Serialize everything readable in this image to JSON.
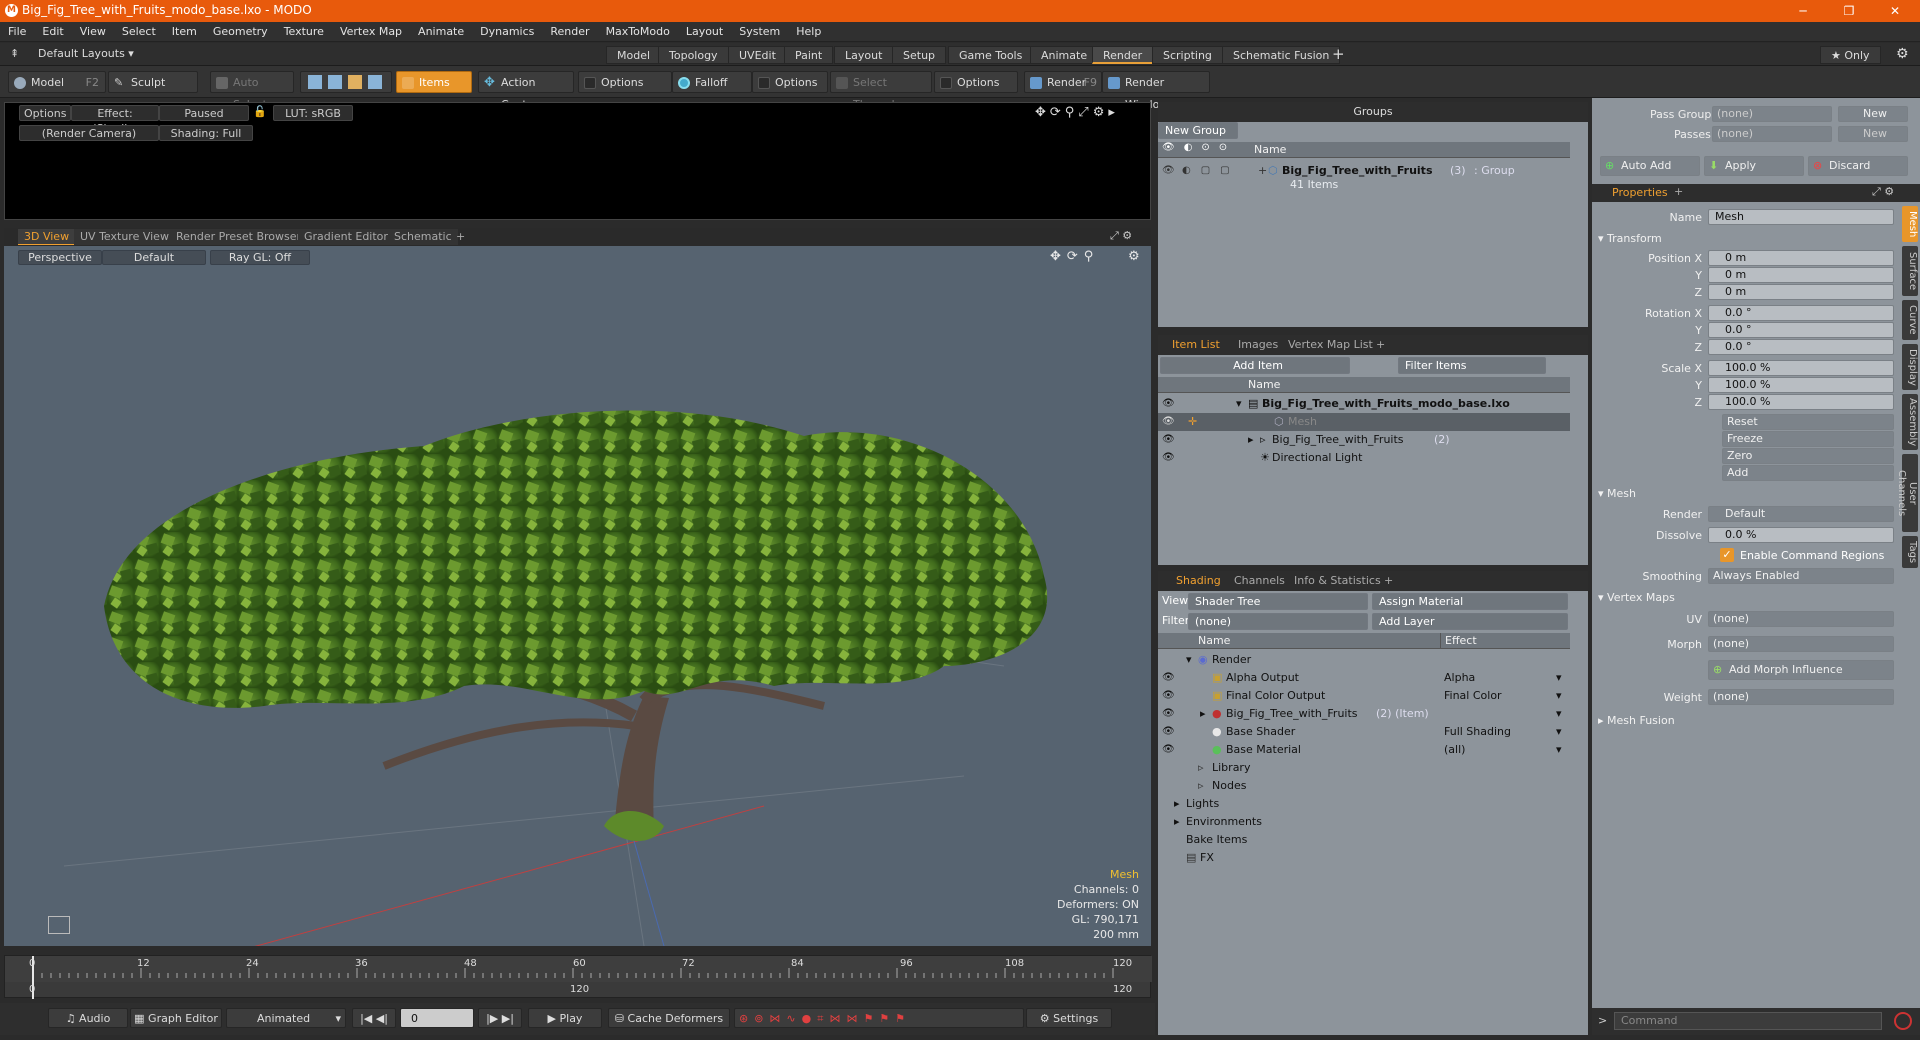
{
  "window": {
    "title": "Big_Fig_Tree_with_Fruits_modo_base.lxo - MODO",
    "logo": "M"
  },
  "menu": [
    "File",
    "Edit",
    "View",
    "Select",
    "Item",
    "Geometry",
    "Texture",
    "Vertex Map",
    "Animate",
    "Dynamics",
    "Render",
    "MaxToModo",
    "Layout",
    "System",
    "Help"
  ],
  "layouts": {
    "default": "Default Layouts ▾",
    "tabs": [
      "Model",
      "Topology",
      "UVEdit",
      "Paint",
      "Layout",
      "Setup",
      "Game Tools",
      "Animate",
      "Render",
      "Scripting",
      "Schematic Fusion"
    ],
    "active": "Render",
    "only": "★ Only"
  },
  "toolbar": {
    "model": "Model",
    "model_key": "F2",
    "sculpt": "Sculpt",
    "auto_select": "Auto Select",
    "items": "Items",
    "action_center": "Action Center",
    "options1": "Options",
    "falloff": "Falloff",
    "options2": "Options",
    "select_through": "Select Through",
    "options3": "Options",
    "render": "Render",
    "render_key": "F9",
    "render_window": "Render Window"
  },
  "render_preview": {
    "options": "Options",
    "effect": "Effect: (Shadi...",
    "paused": "Paused",
    "lut": "LUT: sRGB",
    "camera": "(Render Camera)",
    "shading": "Shading: Full"
  },
  "view_tabs": [
    "3D View",
    "UV Texture View",
    "Render Preset Browser",
    "Gradient Editor",
    "Schematic",
    "+"
  ],
  "viewport": {
    "perspective": "Perspective",
    "default": "Default",
    "raygl": "Ray GL: Off",
    "info_title": "Mesh",
    "channels": "Channels: 0",
    "deformers": "Deformers: ON",
    "gl": "GL: 790,171",
    "scale": "200 mm"
  },
  "timeline": {
    "ticks": [
      "0",
      "12",
      "24",
      "36",
      "48",
      "60",
      "72",
      "84",
      "96",
      "108",
      "120"
    ],
    "sub": [
      "0",
      "120",
      "120"
    ]
  },
  "transport": {
    "audio": "Audio",
    "graph_editor": "Graph Editor",
    "animated": "Animated",
    "frame": "0",
    "play": "Play",
    "cache": "Cache Deformers",
    "settings": "Settings"
  },
  "groups": {
    "title": "Groups",
    "new_group": "New Group",
    "col_name": "Name",
    "item_name": "Big_Fig_Tree_with_Fruits",
    "item_count": "(3)",
    "item_type": ": Group",
    "item_sub": "41 Items"
  },
  "item_list": {
    "tabs": [
      "Item List",
      "Images",
      "Vertex Map List",
      "+"
    ],
    "add_item": "Add Item",
    "filter": "Filter Items",
    "col_name": "Name",
    "rows": [
      {
        "name": "Big_Fig_Tree_with_Fruits_modo_base.lxo",
        "suffix": ""
      },
      {
        "name": "Mesh",
        "suffix": ""
      },
      {
        "name": "Big_Fig_Tree_with_Fruits",
        "suffix": "(2)"
      },
      {
        "name": "Directional Light",
        "suffix": ""
      }
    ]
  },
  "shading": {
    "tabs": [
      "Shading",
      "Channels",
      "Info & Statistics",
      "+"
    ],
    "view_label": "View",
    "view_value": "Shader Tree",
    "assign": "Assign Material",
    "filter_label": "Filter",
    "filter_value": "(none)",
    "add_layer": "Add Layer",
    "col_name": "Name",
    "col_effect": "Effect",
    "rows": [
      {
        "name": "Render",
        "effect": ""
      },
      {
        "name": "Alpha Output",
        "effect": "Alpha"
      },
      {
        "name": "Final Color Output",
        "effect": "Final Color"
      },
      {
        "name": "Big_Fig_Tree_with_Fruits",
        "suffix": "(2) (Item)",
        "effect": ""
      },
      {
        "name": "Base Shader",
        "effect": "Full Shading"
      },
      {
        "name": "Base Material",
        "effect": "(all)"
      },
      {
        "name": "Library",
        "effect": ""
      },
      {
        "name": "Nodes",
        "effect": ""
      },
      {
        "name": "Lights",
        "effect": ""
      },
      {
        "name": "Environments",
        "effect": ""
      },
      {
        "name": "Bake Items",
        "effect": ""
      },
      {
        "name": "FX",
        "effect": ""
      }
    ]
  },
  "passes": {
    "pass_groups": "Pass Groups",
    "passes": "Passes",
    "none1": "(none)",
    "none2": "(none)",
    "new1": "New",
    "new2": "New",
    "auto_add": "Auto Add",
    "apply": "Apply",
    "discard": "Discard"
  },
  "properties": {
    "tab": "Properties",
    "name_label": "Name",
    "name_value": "Mesh",
    "transform": "Transform",
    "position": [
      "0 m",
      "0 m",
      "0 m"
    ],
    "rotation": [
      "0.0 °",
      "0.0 °",
      "0.0 °"
    ],
    "scale": [
      "100.0 %",
      "100.0 %",
      "100.0 %"
    ],
    "pos_label": "Position X",
    "rot_label": "Rotation X",
    "scale_label": "Scale X",
    "y": "Y",
    "z": "Z",
    "reset": "Reset",
    "freeze": "Freeze",
    "zero": "Zero",
    "add": "Add",
    "mesh": "Mesh",
    "render_label": "Render",
    "render_value": "Default",
    "dissolve_label": "Dissolve",
    "dissolve_value": "0.0 %",
    "enable_cmd": "Enable Command Regions",
    "smoothing_label": "Smoothing",
    "smoothing_value": "Always Enabled",
    "vertex_maps": "Vertex Maps",
    "uv_label": "UV",
    "uv_value": "(none)",
    "morph_label": "Morph",
    "morph_value": "(none)",
    "add_morph": "Add Morph Influence",
    "weight_label": "Weight",
    "weight_value": "(none)",
    "mesh_fusion": "Mesh Fusion",
    "side_tabs": [
      "Mesh",
      "Surface",
      "Curve",
      "Display",
      "Assembly",
      "User Channels",
      "Tags"
    ],
    "command": "Command"
  },
  "colors": {
    "accent": "#e8962a",
    "title": "#e85a0c",
    "panel": "#8d949b",
    "viewport": "#566370"
  }
}
